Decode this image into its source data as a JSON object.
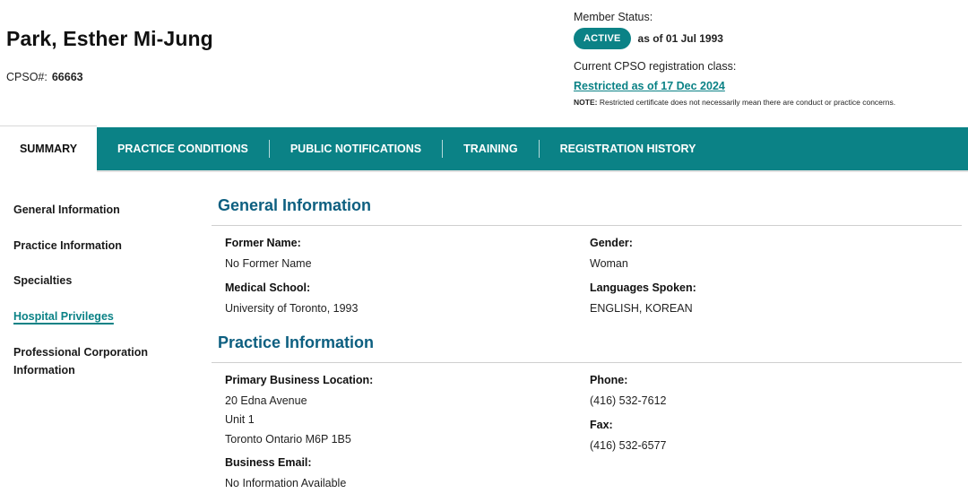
{
  "header": {
    "name": "Park, Esther Mi-Jung",
    "cpso_label": "CPSO#:",
    "cpso_number": "66663",
    "member_status_label": "Member Status:",
    "status_badge": "ACTIVE",
    "status_since": "as of 01 Jul 1993",
    "registration_class_label": "Current CPSO registration class:",
    "registration_class": "Restricted as of 17 Dec 2024",
    "note_label": "NOTE:",
    "note_text": "Restricted certificate does not necessarily mean there are conduct or practice concerns.",
    "accent_color": "#0b8286"
  },
  "tabs": [
    {
      "label": "SUMMARY",
      "active": true
    },
    {
      "label": "PRACTICE CONDITIONS"
    },
    {
      "label": "PUBLIC NOTIFICATIONS"
    },
    {
      "label": "TRAINING"
    },
    {
      "label": "REGISTRATION HISTORY"
    }
  ],
  "sidebar": {
    "items": [
      {
        "label": "General Information"
      },
      {
        "label": "Practice Information"
      },
      {
        "label": "Specialties"
      },
      {
        "label": "Hospital Privileges",
        "active": true
      },
      {
        "label": "Professional Corporation Information"
      }
    ]
  },
  "general": {
    "title": "General Information",
    "former_name_label": "Former Name:",
    "former_name": "No Former Name",
    "gender_label": "Gender:",
    "gender": "Woman",
    "medical_school_label": "Medical School:",
    "medical_school": "University of Toronto, 1993",
    "languages_label": "Languages Spoken:",
    "languages": "ENGLISH, KOREAN"
  },
  "practice": {
    "title": "Practice Information",
    "primary_location_label": "Primary Business Location:",
    "address_lines": [
      "20 Edna Avenue",
      "Unit 1",
      "Toronto Ontario M6P 1B5"
    ],
    "phone_label": "Phone:",
    "phone": "(416) 532-7612",
    "fax_label": "Fax:",
    "fax": "(416) 532-6577",
    "email_label": "Business Email:",
    "email": "No Information Available"
  }
}
